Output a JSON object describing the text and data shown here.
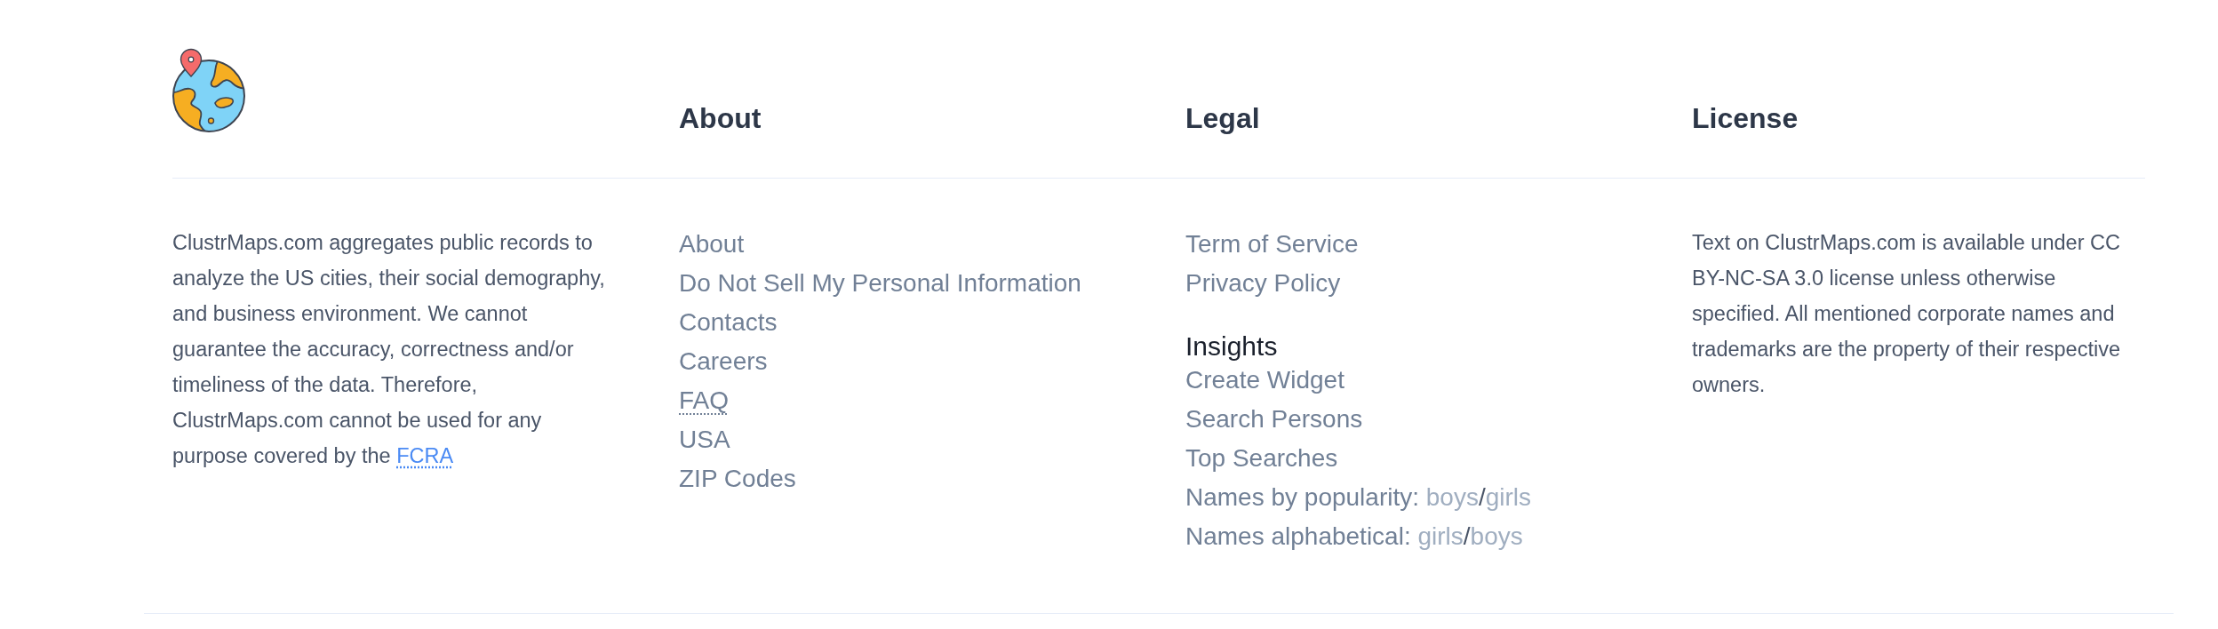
{
  "brand": {
    "description": "ClustrMaps.com aggregates public records to analyze the US cities, their social demography, and business environment. We cannot guarantee the accuracy, correctness and/or timeliness of the data. Therefore, ClustrMaps.com cannot be used for any purpose covered by the",
    "link": "FCRA"
  },
  "columns": [
    {
      "title": "About",
      "kind": "links",
      "links": [
        {
          "label": "About",
          "kind": "link"
        },
        {
          "label": "Do Not Sell My Personal Information",
          "kind": "link"
        },
        {
          "label": "Contacts",
          "kind": "link"
        },
        {
          "label": "Careers",
          "kind": "link"
        },
        {
          "label": "FAQ",
          "kind": "abbr"
        },
        {
          "label": "USA",
          "kind": "link"
        },
        {
          "label": "ZIP Codes",
          "kind": "link"
        }
      ]
    },
    {
      "title": "Legal",
      "kind": "links",
      "links": [
        {
          "label": "Term of Service",
          "kind": "link"
        },
        {
          "label": "Privacy Policy",
          "kind": "link"
        }
      ],
      "sections": [
        {
          "title": "Insights",
          "items": [
            {
              "kind": "link",
              "label": "Create Widget"
            },
            {
              "kind": "link",
              "label": "Search Persons"
            },
            {
              "kind": "link",
              "label": "Top Searches"
            },
            {
              "kind": "pair",
              "label": "Names by popularity:",
              "first": "boys",
              "separator": "/",
              "second": "girls"
            },
            {
              "kind": "pair",
              "label": "Names alphabetical:",
              "first": "girls",
              "separator": "/",
              "second": "boys"
            }
          ]
        }
      ]
    },
    {
      "title": "License",
      "kind": "text",
      "text": "Text on ClustrMaps.com is available under CC BY-NC-SA 3.0 license unless otherwise specified. All mentioned corporate names and trademarks are the property of their respective owners."
    }
  ]
}
